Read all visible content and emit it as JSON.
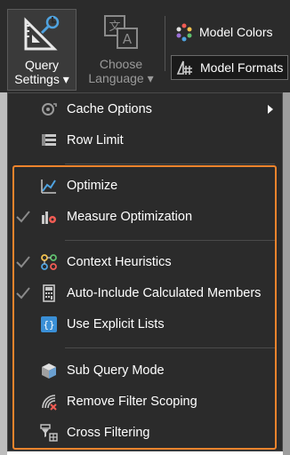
{
  "ribbon": {
    "query_settings": {
      "line1": "Query",
      "line2": "Settings",
      "caret": "▾",
      "icon": "query-settings-icon"
    },
    "choose_language": {
      "line1": "Choose",
      "line2": "Language",
      "caret": "▾",
      "icon": "translate-icon"
    },
    "model_colors": {
      "label": "Model Colors",
      "icon": "palette-icon"
    },
    "model_formats": {
      "label": "Model Formats",
      "icon": "format-icon"
    }
  },
  "menu": {
    "items": [
      {
        "label": "Cache Options",
        "icon": "cache-icon",
        "checked": false,
        "submenu": true
      },
      {
        "label": "Row Limit",
        "icon": "row-limit-icon",
        "checked": false
      },
      {
        "label": "Optimize",
        "icon": "optimize-icon",
        "checked": false
      },
      {
        "label": "Measure Optimization",
        "icon": "measure-optimization-icon",
        "checked": true
      },
      {
        "label": "Context Heuristics",
        "icon": "context-heuristics-icon",
        "checked": true
      },
      {
        "label": "Auto-Include Calculated Members",
        "icon": "calculator-icon",
        "checked": true
      },
      {
        "label": "Use Explicit Lists",
        "icon": "explicit-list-icon",
        "checked": false
      },
      {
        "label": "Sub Query Mode",
        "icon": "cube-icon",
        "checked": false
      },
      {
        "label": "Remove Filter Scoping",
        "icon": "remove-filter-icon",
        "checked": false
      },
      {
        "label": "Cross Filtering",
        "icon": "cross-filter-icon",
        "checked": false
      }
    ]
  },
  "colors": {
    "highlight": "#f0842c",
    "menu_bg": "#2b2b2b",
    "text": "#ffffff"
  }
}
